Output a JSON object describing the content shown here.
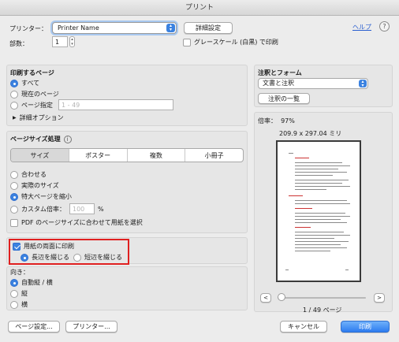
{
  "window": {
    "title": "プリント"
  },
  "top": {
    "printer_label": "プリンター：",
    "printer_value": "Printer Name",
    "detail_settings_button": "詳細設定",
    "help_link": "ヘルプ",
    "help_icon_glyph": "?",
    "copies_label": "部数：",
    "copies_value": "1",
    "grayscale_label": "グレースケール (白黒) で印刷",
    "grayscale_checked": false
  },
  "pages": {
    "heading": "印刷するページ",
    "options": [
      {
        "label": "すべて",
        "selected": true
      },
      {
        "label": "現在のページ",
        "selected": false
      },
      {
        "label": "ページ指定",
        "selected": false
      }
    ],
    "range_placeholder": "1 - 49",
    "more_options": "詳細オプション",
    "disclosure_glyph": "▶"
  },
  "sizing": {
    "heading": "ページサイズ処理",
    "info_glyph": "i",
    "tabs": [
      "サイズ",
      "ポスター",
      "複数",
      "小冊子"
    ],
    "active_tab": "サイズ",
    "options": [
      {
        "label": "合わせる",
        "selected": false
      },
      {
        "label": "実際のサイズ",
        "selected": false
      },
      {
        "label": "特大ページを縮小",
        "selected": true
      },
      {
        "label": "カスタム倍率：",
        "selected": false
      }
    ],
    "custom_scale_value": "100",
    "percent_sign": "%",
    "pdf_paper_label": "PDF のページサイズに合わせて用紙を選択",
    "pdf_paper_checked": false
  },
  "duplex": {
    "label": "用紙の両面に印刷",
    "checked": true,
    "long_edge": "長辺を綴じる",
    "short_edge": "短辺を綴じる",
    "selected": "long"
  },
  "orientation": {
    "heading": "向き：",
    "options": [
      {
        "label": "自動縦 / 横",
        "selected": true
      },
      {
        "label": "縦",
        "selected": false
      },
      {
        "label": "横",
        "selected": false
      }
    ]
  },
  "comments": {
    "heading": "注釈とフォーム",
    "select_value": "文書と注釈",
    "summary_button": "注釈の一覧"
  },
  "preview": {
    "zoom_label": "倍率：  97%",
    "dimensions": "209.9 x 297.04 ミリ",
    "page_indicator": "1 / 49 ページ",
    "prev_glyph": "<",
    "next_glyph": ">"
  },
  "footer": {
    "page_setup_button": "ページ設定...",
    "printer_button": "プリンター...",
    "cancel_button": "キャンセル",
    "print_button": "印刷"
  },
  "colors": {
    "accent_blue": "#3b82e0",
    "highlight_red": "#e02020"
  }
}
